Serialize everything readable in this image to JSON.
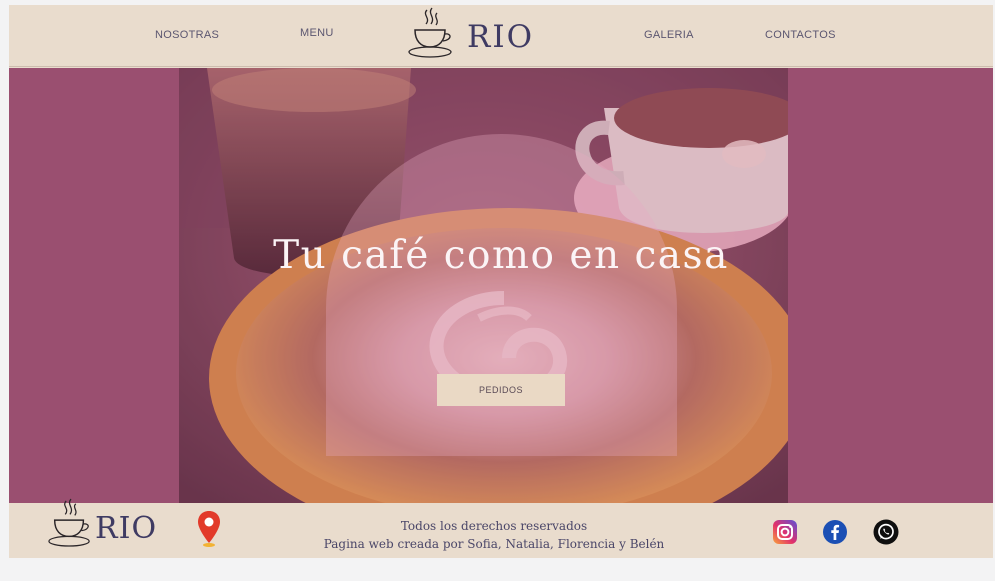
{
  "nav": {
    "items": [
      "NOSOTRAS",
      "MENU",
      "GALERIA",
      "CONTACTOS"
    ]
  },
  "brand": {
    "name": "RIO"
  },
  "hero": {
    "title": "Tu café como en casa",
    "button_label": "PEDIDOS"
  },
  "footer": {
    "brand": "RIO",
    "rights": "Todos los derechos reservados",
    "credits": "Pagina web creada por Sofia, Natalia, Florencia y Belén",
    "icons": [
      "location-pin-icon",
      "instagram-icon",
      "facebook-icon",
      "whatsapp-icon"
    ]
  },
  "colors": {
    "cream": "#e9dccd",
    "mauve": "#9a4f70",
    "ink": "#3f3b63"
  }
}
